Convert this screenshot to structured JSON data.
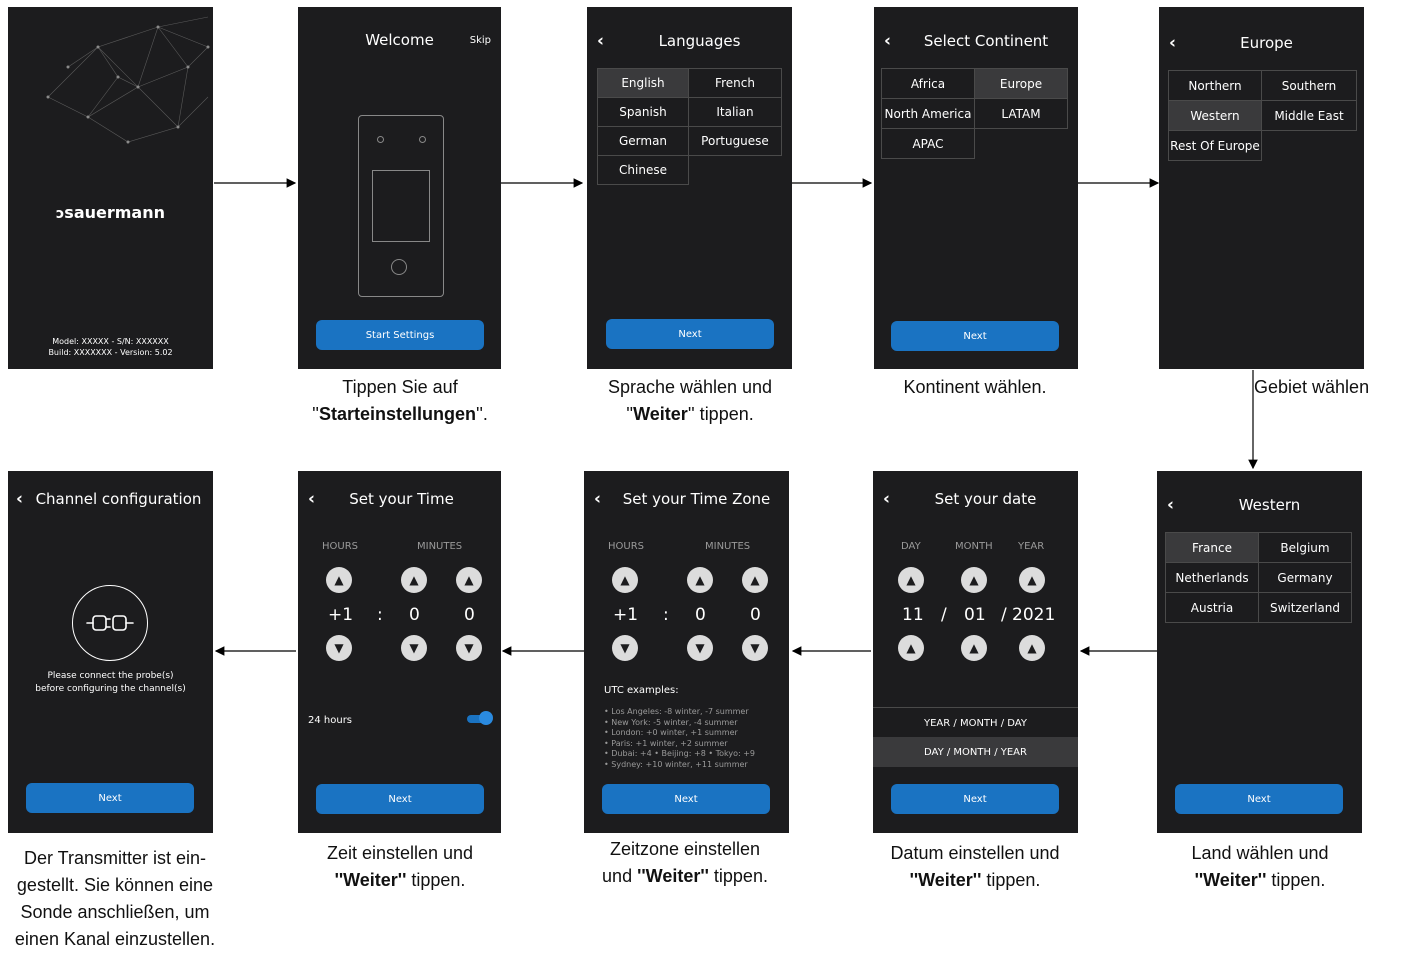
{
  "s1": {
    "logo": "sauermann",
    "model": "Model: XXXXX - S/N: XXXXXX",
    "build": "Build: XXXXXXX - Version: 5.02"
  },
  "s2": {
    "title": "Welcome",
    "skip": "Skip",
    "button": "Start Settings"
  },
  "s3": {
    "title": "Languages",
    "languages": [
      "English",
      "French",
      "Spanish",
      "Italian",
      "German",
      "Portuguese",
      "Chinese"
    ],
    "button": "Next"
  },
  "s4": {
    "title": "Select Continent",
    "continents": [
      "Africa",
      "Europe",
      "North America",
      "LATAM",
      "APAC"
    ],
    "button": "Next"
  },
  "s5": {
    "title": "Europe",
    "regions": [
      "Northern",
      "Southern",
      "Western",
      "Middle East",
      "Rest Of Europe"
    ]
  },
  "s6": {
    "title": "Western",
    "countries": [
      "France",
      "Belgium",
      "Netherlands",
      "Germany",
      "Austria",
      "Switzerland"
    ],
    "button": "Next"
  },
  "s7": {
    "title": "Set your date",
    "day_label": "DAY",
    "month_label": "MONTH",
    "year_label": "YEAR",
    "day": "11",
    "month": "01",
    "year": "2021",
    "sep": "/",
    "fmt1": "YEAR / MONTH / DAY",
    "fmt2": "DAY / MONTH / YEAR",
    "button": "Next"
  },
  "s8": {
    "title": "Set your Time Zone",
    "hours_label": "HOURS",
    "minutes_label": "MINUTES",
    "hours": "+1",
    "colon": ":",
    "min1": "0",
    "min2": "0",
    "utc_title": "UTC examples:",
    "utc_lines": [
      "• Los Angeles: -8 winter, -7 summer",
      "• New York: -5 winter, -4 summer",
      "• London: +0 winter, +1 summer",
      "• Paris: +1 winter, +2 summer",
      "• Dubai: +4  • Beijing: +8  • Tokyo: +9",
      "• Sydney: +10 winter, +11 summer"
    ],
    "button": "Next"
  },
  "s9": {
    "title": "Set your Time",
    "hours_label": "HOURS",
    "minutes_label": "MINUTES",
    "hours": "+1",
    "colon": ":",
    "min1": "0",
    "min2": "0",
    "toggle_label": "24 hours",
    "button": "Next"
  },
  "s10": {
    "title": "Channel configuration",
    "msg1": "Please connect the probe(s)",
    "msg2": "before configuring the channel(s)",
    "button": "Next"
  },
  "captions": {
    "c2a": "Tippen Sie auf",
    "c2b_pre": "''",
    "c2b_bold": "Starteinstellungen",
    "c2b_post": "''.",
    "c3a": "Sprache wählen und",
    "c3b_pre": "''",
    "c3b_bold": "Weiter",
    "c3b_post": "'' tippen.",
    "c4": "Kontinent wählen.",
    "c5": "Gebiet wählen",
    "c6a": "Land wählen und",
    "c6b_bold": "''Weiter''",
    "c6b_post": " tippen.",
    "c7a": "Datum einstellen und",
    "c7b_bold": "''Weiter''",
    "c7b_post": " tippen.",
    "c8a": "Zeitzone einstellen",
    "c8b_pre": "und ",
    "c8b_bold": "''Weiter''",
    "c8b_post": " tippen.",
    "c9a": "Zeit einstellen und",
    "c9b_bold": "''Weiter''",
    "c9b_post": " tippen.",
    "c10": [
      "Der Transmitter ist ein-",
      "gestellt. Sie können eine",
      "Sonde anschließen, um",
      "einen Kanal einzustellen."
    ]
  },
  "colors": {
    "screen_bg": "#1c1c1e",
    "button": "#1a73c2",
    "selected": "#3a3a3c"
  }
}
